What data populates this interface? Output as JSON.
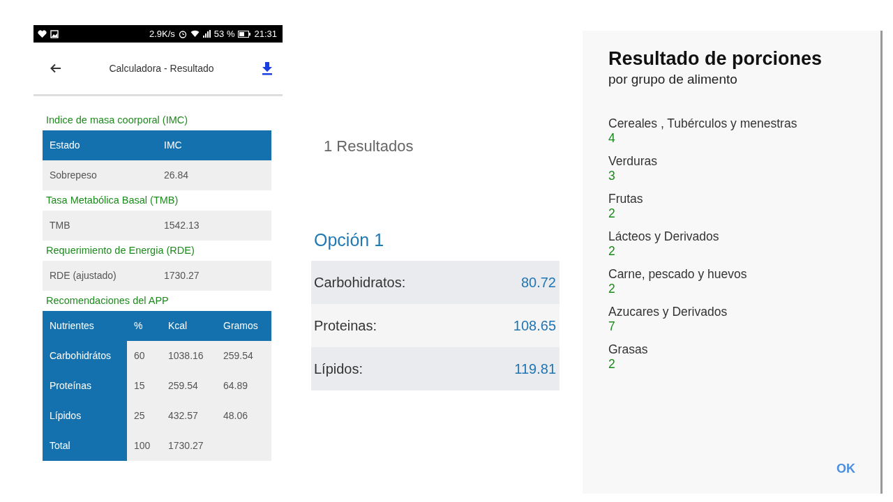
{
  "phone": {
    "status_bar": {
      "speed": "2.9K/s",
      "signal": "53 %",
      "time": "21:31"
    },
    "app_bar": {
      "title": "Calculadora - Resultado"
    },
    "sections": [
      {
        "title": "Indice de masa coorporal (IMC)",
        "kind": "header_table",
        "header": [
          "Estado",
          "IMC"
        ],
        "rows": [
          [
            "Sobrepeso",
            "26.84"
          ]
        ]
      },
      {
        "title": "Tasa Metabólica Basal (TMB)",
        "kind": "plain_table",
        "rows": [
          [
            "TMB",
            "1542.13"
          ]
        ]
      },
      {
        "title": "Requerimiento de Energia (RDE)",
        "kind": "plain_table",
        "rows": [
          [
            "RDE (ajustado)",
            "1730.27"
          ]
        ]
      },
      {
        "title": "Recomendaciones del APP",
        "kind": "nutrient_table",
        "header": [
          "Nutrientes",
          "%",
          "Kcal",
          "Gramos"
        ],
        "rows": [
          [
            "Carbohidrátos",
            "60",
            "1038.16",
            "259.54"
          ],
          [
            "Proteínas",
            "15",
            "259.54",
            "64.89"
          ],
          [
            "Lípidos",
            "25",
            "432.57",
            "48.06"
          ],
          [
            "Total",
            "100",
            "1730.27",
            ""
          ]
        ]
      }
    ]
  },
  "results": {
    "count": "1 Resultados",
    "option_title": "Opción 1",
    "rows": [
      {
        "label": "Carbohidratos:",
        "value": "80.72"
      },
      {
        "label": "Proteinas:",
        "value": "108.65"
      },
      {
        "label": "Lípidos:",
        "value": "119.81"
      }
    ]
  },
  "dialog": {
    "title": "Resultado de porciones",
    "subtitle": "por grupo de alimento",
    "groups": [
      {
        "name": "Cereales , Tubérculos y menestras",
        "portions": "4"
      },
      {
        "name": "Verduras",
        "portions": "3"
      },
      {
        "name": "Frutas",
        "portions": "2"
      },
      {
        "name": "Lácteos y Derivados",
        "portions": "2"
      },
      {
        "name": "Carne, pescado y huevos",
        "portions": "2"
      },
      {
        "name": "Azucares y Derivados",
        "portions": "7"
      },
      {
        "name": "Grasas",
        "portions": "2"
      }
    ],
    "ok": "OK"
  }
}
